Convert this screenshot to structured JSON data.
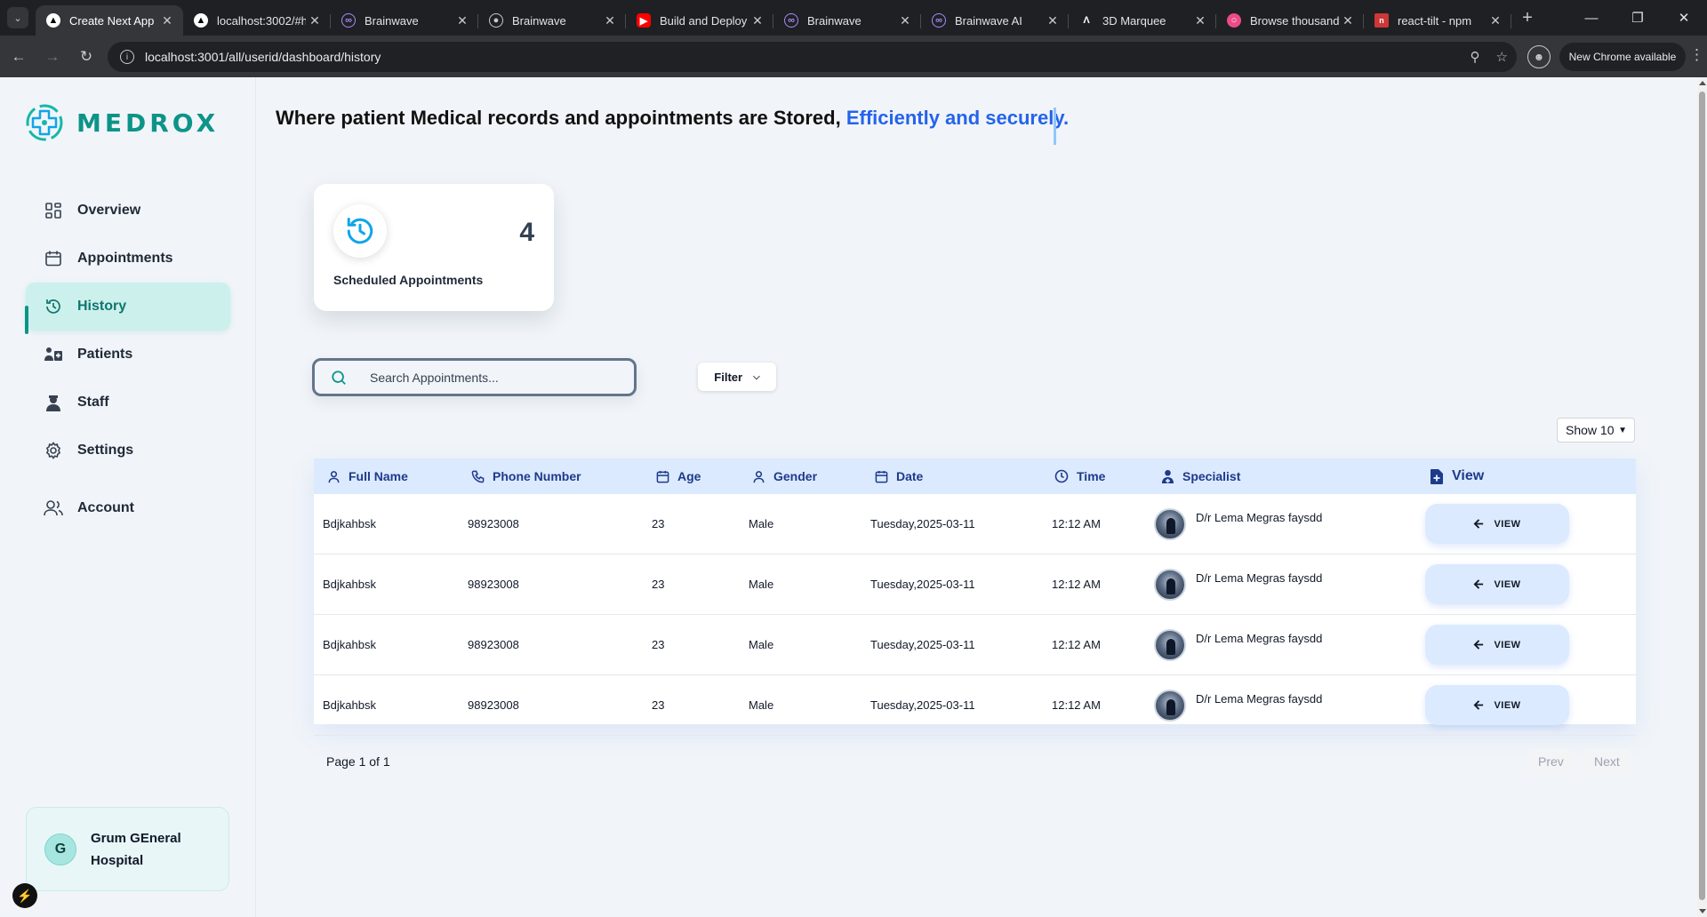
{
  "browser": {
    "tabs": [
      {
        "title": "Create Next App",
        "icon": "next-logo-icon",
        "active": true
      },
      {
        "title": "localhost:3002/#h",
        "icon": "next-logo-icon",
        "active": false
      },
      {
        "title": "Brainwave",
        "icon": "brainwave-icon",
        "active": false
      },
      {
        "title": "Brainwave",
        "icon": "globe-icon",
        "active": false
      },
      {
        "title": "Build and Deploy",
        "icon": "youtube-icon",
        "active": false
      },
      {
        "title": "Brainwave",
        "icon": "brainwave-icon",
        "active": false
      },
      {
        "title": "Brainwave AI",
        "icon": "brainwave-icon",
        "active": false
      },
      {
        "title": "3D Marquee",
        "icon": "aceternity-icon",
        "active": false
      },
      {
        "title": "Browse thousand",
        "icon": "dribbble-icon",
        "active": false
      },
      {
        "title": "react-tilt - npm",
        "icon": "npm-icon",
        "active": false
      }
    ],
    "url": "localhost:3001/all/userid/dashboard/history",
    "update_label": "New Chrome available"
  },
  "brand": {
    "name": "MEDROX",
    "color": "#0d9488"
  },
  "sidebar": {
    "items": [
      {
        "label": "Overview",
        "icon": "grid-icon",
        "active": false
      },
      {
        "label": "Appointments",
        "icon": "calendar-icon",
        "active": false
      },
      {
        "label": "History",
        "icon": "history-icon",
        "active": true
      },
      {
        "label": "Patients",
        "icon": "patients-icon",
        "active": false
      },
      {
        "label": "Staff",
        "icon": "staff-icon",
        "active": false
      },
      {
        "label": "Settings",
        "icon": "gear-icon",
        "active": false
      },
      {
        "label": "Account",
        "icon": "users-icon",
        "active": false
      }
    ],
    "hospital": {
      "initial": "G",
      "name": "Grum GEneral Hospital"
    }
  },
  "headline": {
    "text": "Where patient Medical records and appointments are Stored, ",
    "accent": "Efficiently and securely.",
    "accent_color": "#2563eb"
  },
  "stat": {
    "count": "4",
    "label": "Scheduled Appointments"
  },
  "search": {
    "placeholder": "Search Appointments..."
  },
  "filter": {
    "label": "Filter"
  },
  "page_size": {
    "label": "Show 10"
  },
  "table": {
    "columns": [
      {
        "label": "Full Name",
        "icon": "user-icon"
      },
      {
        "label": "Phone Number",
        "icon": "phone-icon"
      },
      {
        "label": "Age",
        "icon": "calendar-icon"
      },
      {
        "label": "Gender",
        "icon": "user-icon"
      },
      {
        "label": "Date",
        "icon": "calendar-icon"
      },
      {
        "label": "Time",
        "icon": "clock-icon"
      },
      {
        "label": "Specialist",
        "icon": "doctor-icon"
      },
      {
        "label": "View",
        "icon": "file-plus-icon"
      }
    ],
    "rows": [
      {
        "name": "Bdjkahbsk",
        "phone": "98923008",
        "age": "23",
        "gender": "Male",
        "date": "Tuesday,2025-03-11",
        "time": "12:12 AM",
        "specialist": "D/r Lema Megras faysdd",
        "action": "VIEW"
      },
      {
        "name": "Bdjkahbsk",
        "phone": "98923008",
        "age": "23",
        "gender": "Male",
        "date": "Tuesday,2025-03-11",
        "time": "12:12 AM",
        "specialist": "D/r Lema Megras faysdd",
        "action": "VIEW"
      },
      {
        "name": "Bdjkahbsk",
        "phone": "98923008",
        "age": "23",
        "gender": "Male",
        "date": "Tuesday,2025-03-11",
        "time": "12:12 AM",
        "specialist": "D/r Lema Megras faysdd",
        "action": "VIEW"
      },
      {
        "name": "Bdjkahbsk",
        "phone": "98923008",
        "age": "23",
        "gender": "Male",
        "date": "Tuesday,2025-03-11",
        "time": "12:12 AM",
        "specialist": "D/r Lema Megras faysdd",
        "action": "VIEW"
      }
    ],
    "pagination": {
      "info": "Page 1 of 1",
      "prev": "Prev",
      "next": "Next"
    }
  }
}
